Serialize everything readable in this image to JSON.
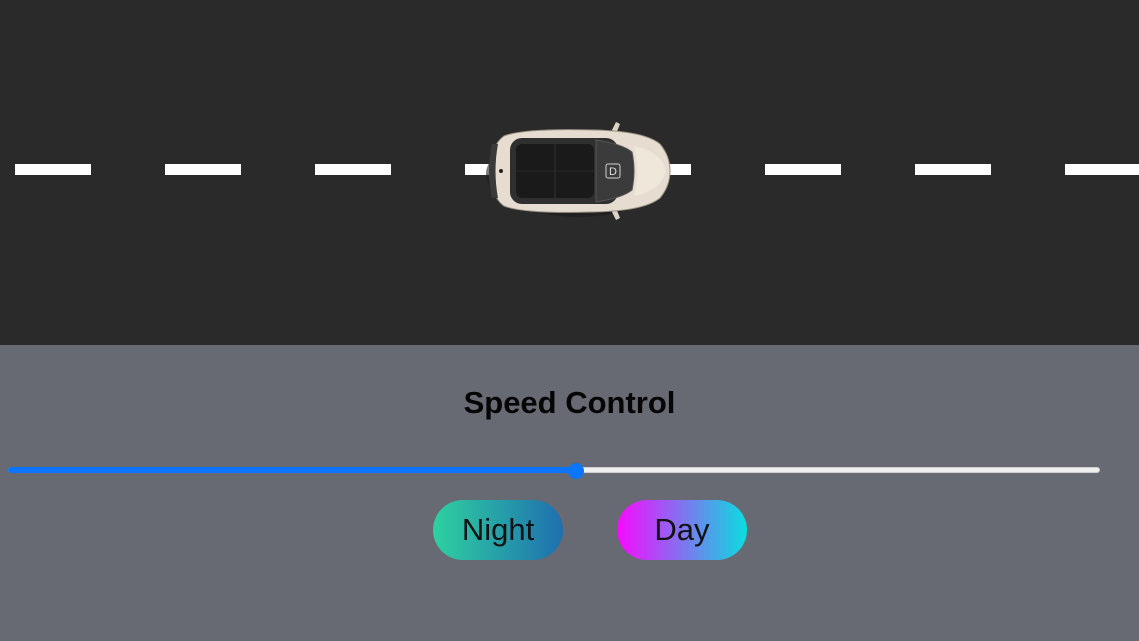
{
  "road": {
    "lane_color": "#ffffff",
    "road_color": "#2a2a2a",
    "dash_count": 8
  },
  "car": {
    "icon": "car-topdown-icon",
    "gear_label": "D",
    "body_color": "#e6ddd0"
  },
  "controls": {
    "title": "Speed Control",
    "speed": {
      "value": 52,
      "min": 0,
      "max": 100,
      "accent": "#0a75ff"
    },
    "buttons": {
      "night_label": "Night",
      "day_label": "Day"
    }
  }
}
